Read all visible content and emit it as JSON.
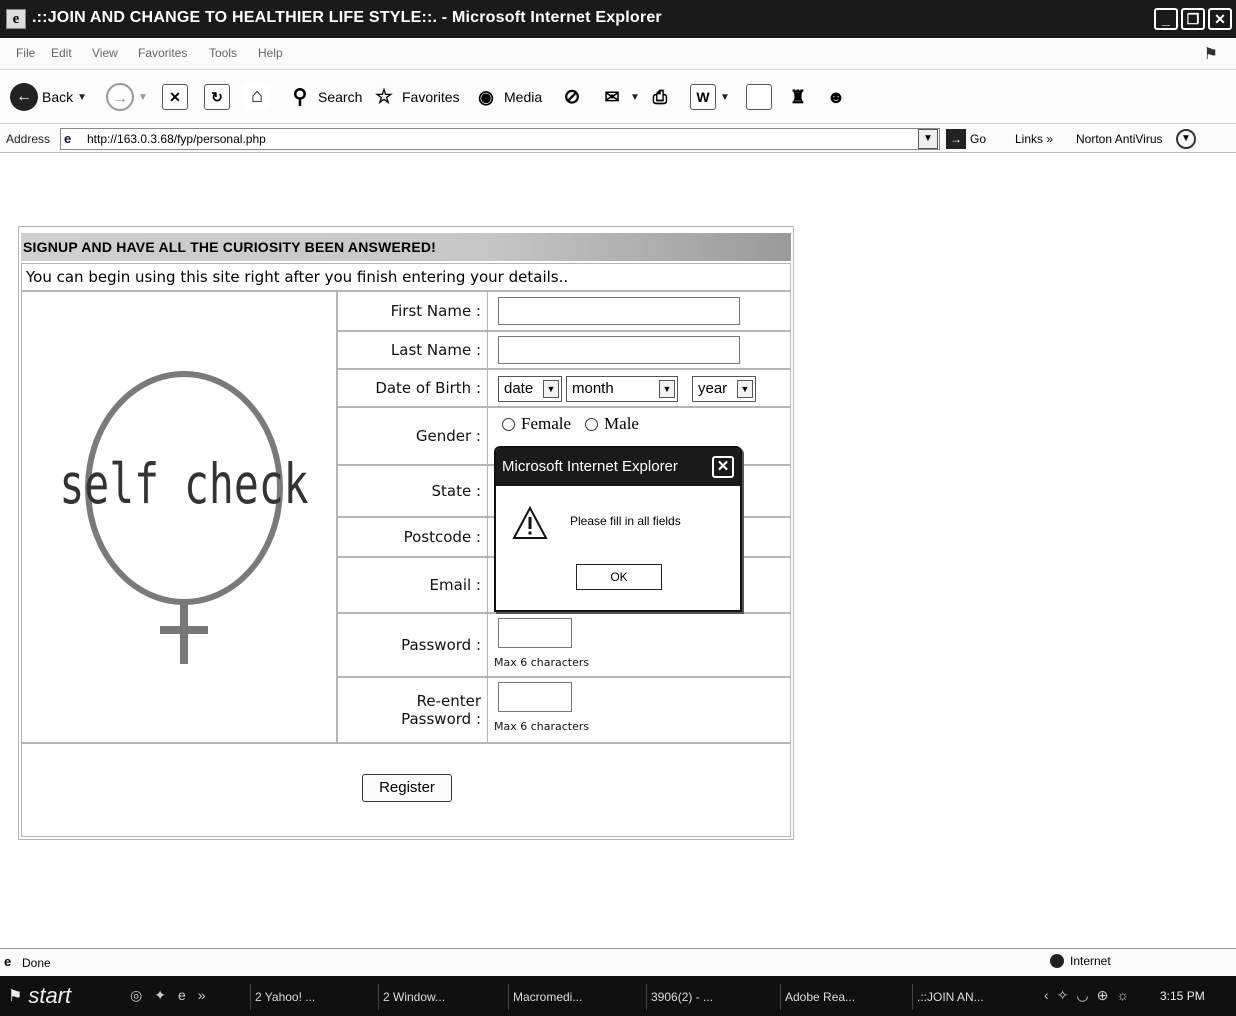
{
  "window": {
    "title": ".::JOIN AND CHANGE TO HEALTHIER LIFE STYLE::. - Microsoft Internet Explorer",
    "app_icon": "e"
  },
  "menu": [
    "File",
    "Edit",
    "View",
    "Favorites",
    "Tools",
    "Help"
  ],
  "toolbar": {
    "back": "Back",
    "search": "Search",
    "favorites": "Favorites",
    "media": "Media"
  },
  "address": {
    "label": "Address",
    "url": "http://163.0.3.68/fyp/personal.php",
    "go": "Go",
    "links": "Links",
    "norton": "Norton AntiVirus"
  },
  "form": {
    "header": "SIGNUP AND HAVE ALL THE CURIOSITY BEEN ANSWERED!",
    "intro": "You can begin using this site right after you finish entering your details..",
    "logo_text": "self check",
    "fields": {
      "first_name": "First Name :",
      "last_name": "Last Name :",
      "dob": "Date of Birth :",
      "gender": "Gender :",
      "state": "State :",
      "postcode": "Postcode :",
      "email": "Email :",
      "password": "Password :",
      "reenter_line1": "Re-enter",
      "reenter_line2": "Password :"
    },
    "dob_selects": {
      "date": "date",
      "month": "month",
      "year": "year"
    },
    "gender_options": {
      "female": "Female",
      "male": "Male"
    },
    "password_hint": "Max 6 characters",
    "reenter_hint": "Max 6 characters",
    "register": "Register"
  },
  "dialog": {
    "title": "Microsoft Internet Explorer",
    "message": "Please fill in all fields",
    "ok": "OK"
  },
  "status": {
    "text": "Done",
    "zone": "Internet"
  },
  "taskbar": {
    "start": "start",
    "tasks": [
      "2 Yahoo! ...",
      "2 Window...",
      "Macromedi...",
      "3906(2) - ...",
      "Adobe Rea...",
      ".::JOIN AN..."
    ],
    "clock": "3:15 PM"
  }
}
